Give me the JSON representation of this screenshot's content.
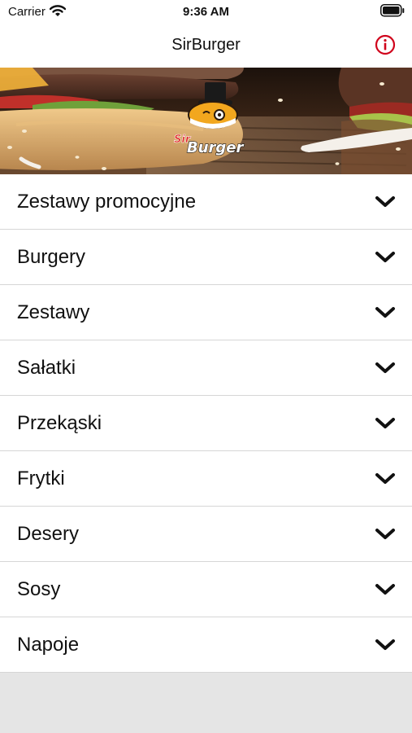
{
  "status_bar": {
    "carrier": "Carrier",
    "time": "9:36 AM"
  },
  "nav": {
    "title": "SirBurger"
  },
  "banner": {
    "logo_small": "Sir",
    "logo_large": "Burger"
  },
  "menu": {
    "items": [
      {
        "label": "Zestawy promocyjne"
      },
      {
        "label": "Burgery"
      },
      {
        "label": "Zestawy"
      },
      {
        "label": "Sałatki"
      },
      {
        "label": "Przekąski"
      },
      {
        "label": "Frytki"
      },
      {
        "label": "Desery"
      },
      {
        "label": "Sosy"
      },
      {
        "label": "Napoje"
      }
    ]
  },
  "colors": {
    "accent": "#d0021b",
    "background": "#e5e5e5",
    "row_background": "#ffffff",
    "divider": "#d6d6d6"
  },
  "icons": {
    "wifi": "wifi-icon",
    "battery": "battery-icon",
    "info": "info-icon",
    "chevron": "chevron-down-icon"
  }
}
